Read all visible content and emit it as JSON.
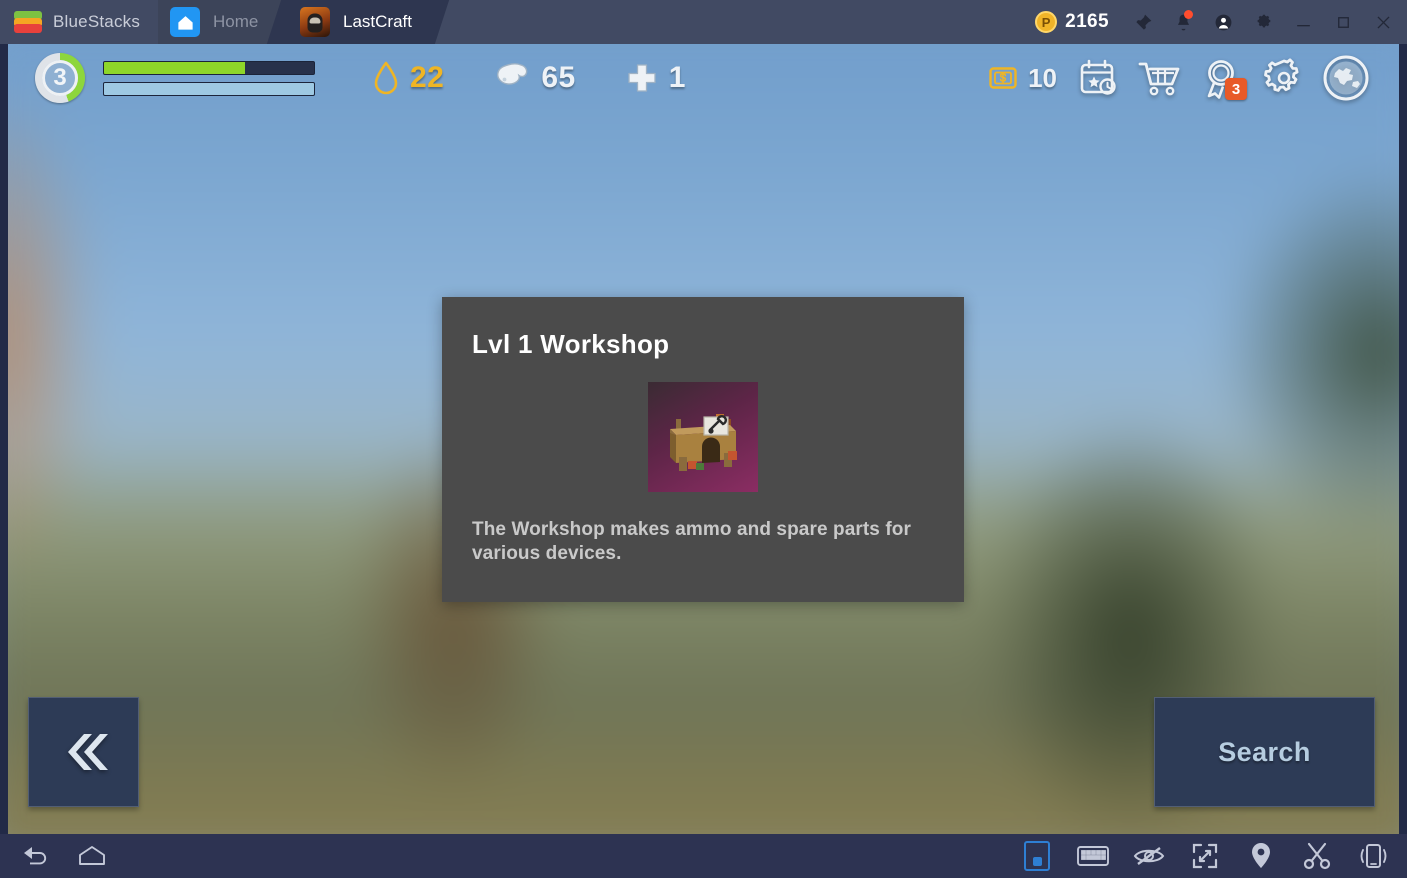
{
  "titlebar": {
    "brand": "BlueStacks",
    "tabs": [
      {
        "label": "Home",
        "icon": "home-icon",
        "active": false
      },
      {
        "label": "LastCraft",
        "icon": "lastcraft-app-icon",
        "active": true
      }
    ],
    "points_value": "2165",
    "points_icon": "coin-icon",
    "buttons": [
      {
        "name": "pin-button",
        "icon": "pin-icon"
      },
      {
        "name": "notifications-button",
        "icon": "bell-icon",
        "badge": true
      },
      {
        "name": "account-button",
        "icon": "user-avatar-icon"
      },
      {
        "name": "settings-button",
        "icon": "gear-icon"
      },
      {
        "name": "minimize-button",
        "icon": "minimize-icon"
      },
      {
        "name": "maximize-button",
        "icon": "maximize-icon"
      },
      {
        "name": "close-button",
        "icon": "close-icon"
      }
    ]
  },
  "hud": {
    "level": "3",
    "level_progress_pct": 45,
    "health_pct": 67,
    "stamina_pct": 100,
    "resources": [
      {
        "name": "water",
        "icon": "water-drop-icon",
        "value": "22",
        "color": "#efb525"
      },
      {
        "name": "food",
        "icon": "meat-drumstick-icon",
        "value": "65",
        "color": "#eef2f6"
      },
      {
        "name": "health-kit",
        "icon": "medical-cross-icon",
        "value": "1",
        "color": "#eef2f6"
      }
    ],
    "money": {
      "icon": "money-bill-icon",
      "value": "10"
    },
    "icons": [
      {
        "name": "daily-events-button",
        "icon": "calendar-star-clock-icon",
        "badge": null
      },
      {
        "name": "shop-button",
        "icon": "shopping-cart-icon",
        "badge": null
      },
      {
        "name": "achievements-button",
        "icon": "medal-ribbon-icon",
        "badge": "3"
      },
      {
        "name": "settings-button",
        "icon": "gear-icon",
        "badge": null
      },
      {
        "name": "world-map-button",
        "icon": "globe-icon",
        "badge": null
      }
    ]
  },
  "dialog": {
    "title": "Lvl 1 Workshop",
    "image_name": "workshop-building-thumbnail",
    "description": "The Workshop makes ammo and spare parts for various devices."
  },
  "actions": {
    "back_label": "",
    "back_icon": "double-chevron-left-icon",
    "search_label": "Search"
  },
  "bottombar": {
    "left": [
      {
        "name": "android-back-button",
        "icon": "back-arrow-icon"
      },
      {
        "name": "android-home-button",
        "icon": "home-outline-icon"
      }
    ],
    "right": [
      {
        "name": "game-controls-button",
        "icon": "phone-select-icon",
        "selected": true
      },
      {
        "name": "keyboard-controls-button",
        "icon": "keyboard-icon"
      },
      {
        "name": "hide-controls-button",
        "icon": "eye-slash-icon"
      },
      {
        "name": "fullscreen-button",
        "icon": "fullscreen-expand-icon"
      },
      {
        "name": "location-button",
        "icon": "location-pin-icon"
      },
      {
        "name": "cut-button",
        "icon": "scissors-icon"
      },
      {
        "name": "shake-button",
        "icon": "phone-shake-icon"
      }
    ]
  },
  "colors": {
    "titlebar_bg": "#414a63",
    "tab_active_bg": "#2e3650",
    "bottombar_bg": "#2d3352",
    "dialog_bg": "#4b4b4b",
    "button_bg": "#2d3b56",
    "accent_green": "#8ed629",
    "accent_amber": "#efb525",
    "badge_orange": "#e85a28"
  }
}
